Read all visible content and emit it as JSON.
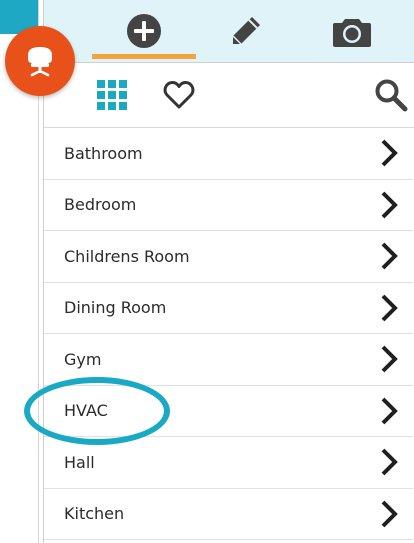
{
  "colors": {
    "accent_teal": "#1fa8c4",
    "fab_orange": "#e8521a",
    "tab_bg": "#dff3f8",
    "tab_underline": "#f2a53a",
    "grid_icon": "#1aa9c4",
    "icon_dark": "#444444",
    "highlight_ring": "#1aa9c4"
  },
  "fab": {
    "icon": "chair-icon"
  },
  "top_tabs": [
    {
      "icon": "plus-circle-icon",
      "active": true
    },
    {
      "icon": "pencil-icon",
      "active": false
    },
    {
      "icon": "camera-icon",
      "active": false
    }
  ],
  "toolbar": {
    "grid_icon": "grid-icon",
    "favorite_icon": "heart-icon",
    "search_icon": "search-icon"
  },
  "rooms": [
    {
      "label": "Bathroom"
    },
    {
      "label": "Bedroom"
    },
    {
      "label": "Childrens Room"
    },
    {
      "label": "Dining Room"
    },
    {
      "label": "Gym"
    },
    {
      "label": "HVAC"
    },
    {
      "label": "Hall"
    },
    {
      "label": "Kitchen"
    }
  ]
}
